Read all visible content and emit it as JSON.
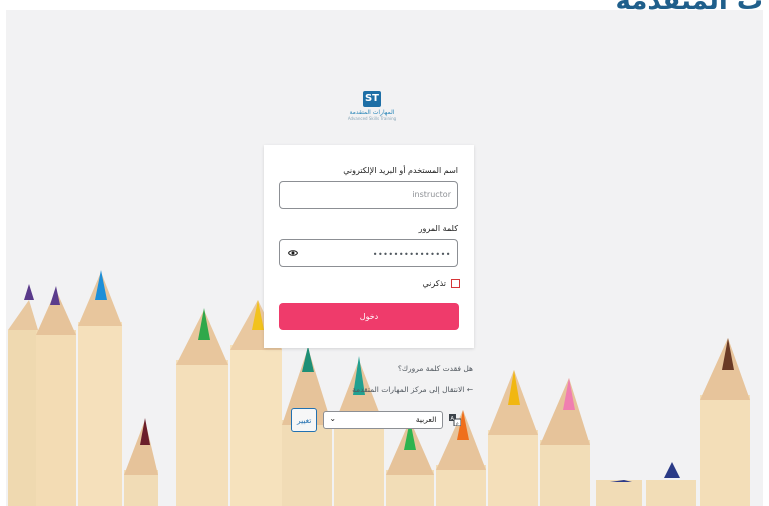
{
  "header": {
    "corner_brand_text": "ت المتقدمة"
  },
  "logo": {
    "mark": "ST",
    "name": "المهارات المتقدمة",
    "subtitle": "Advanced Skills Training"
  },
  "login_form": {
    "username_label": "اسم المستخدم أو البريد الإلكتروني",
    "username_value": "instructor",
    "password_label": "كلمة المرور",
    "password_masked": "•••••••••••••••",
    "remember_label": "تذكرني",
    "submit_label": "دخول"
  },
  "links": {
    "lost_password": "هل فقدت كلمة مرورك؟",
    "back_to_site": "← الانتقال إلى مركز المهارات المتقدمة"
  },
  "language": {
    "selected": "العربية",
    "change_button": "تغيير"
  },
  "colors": {
    "accent": "#ef3b6b",
    "link": "#2271b1",
    "checkbox_border": "#d63638"
  }
}
